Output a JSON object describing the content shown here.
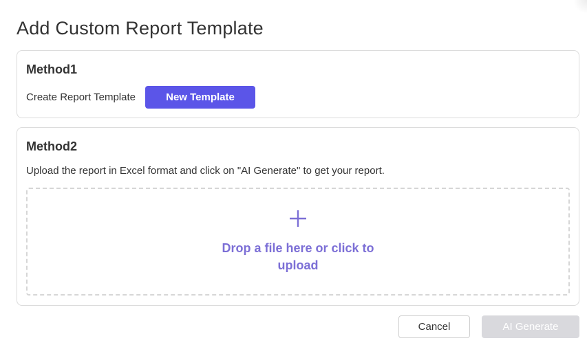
{
  "dialog": {
    "title": "Add Custom Report Template"
  },
  "method1": {
    "heading": "Method1",
    "description": "Create Report Template",
    "new_template_label": "New Template"
  },
  "method2": {
    "heading": "Method2",
    "description": "Upload the report in Excel format and click on \"AI Generate\" to get your report.",
    "dropzone_icon": "plus-icon",
    "dropzone_text": "Drop a file here or click to upload"
  },
  "footer": {
    "cancel_label": "Cancel",
    "ai_generate_label": "AI Generate"
  },
  "colors": {
    "primary": "#5b55e8",
    "dropzone_text": "#7c6fd6",
    "disabled": "#d9d9dd"
  }
}
